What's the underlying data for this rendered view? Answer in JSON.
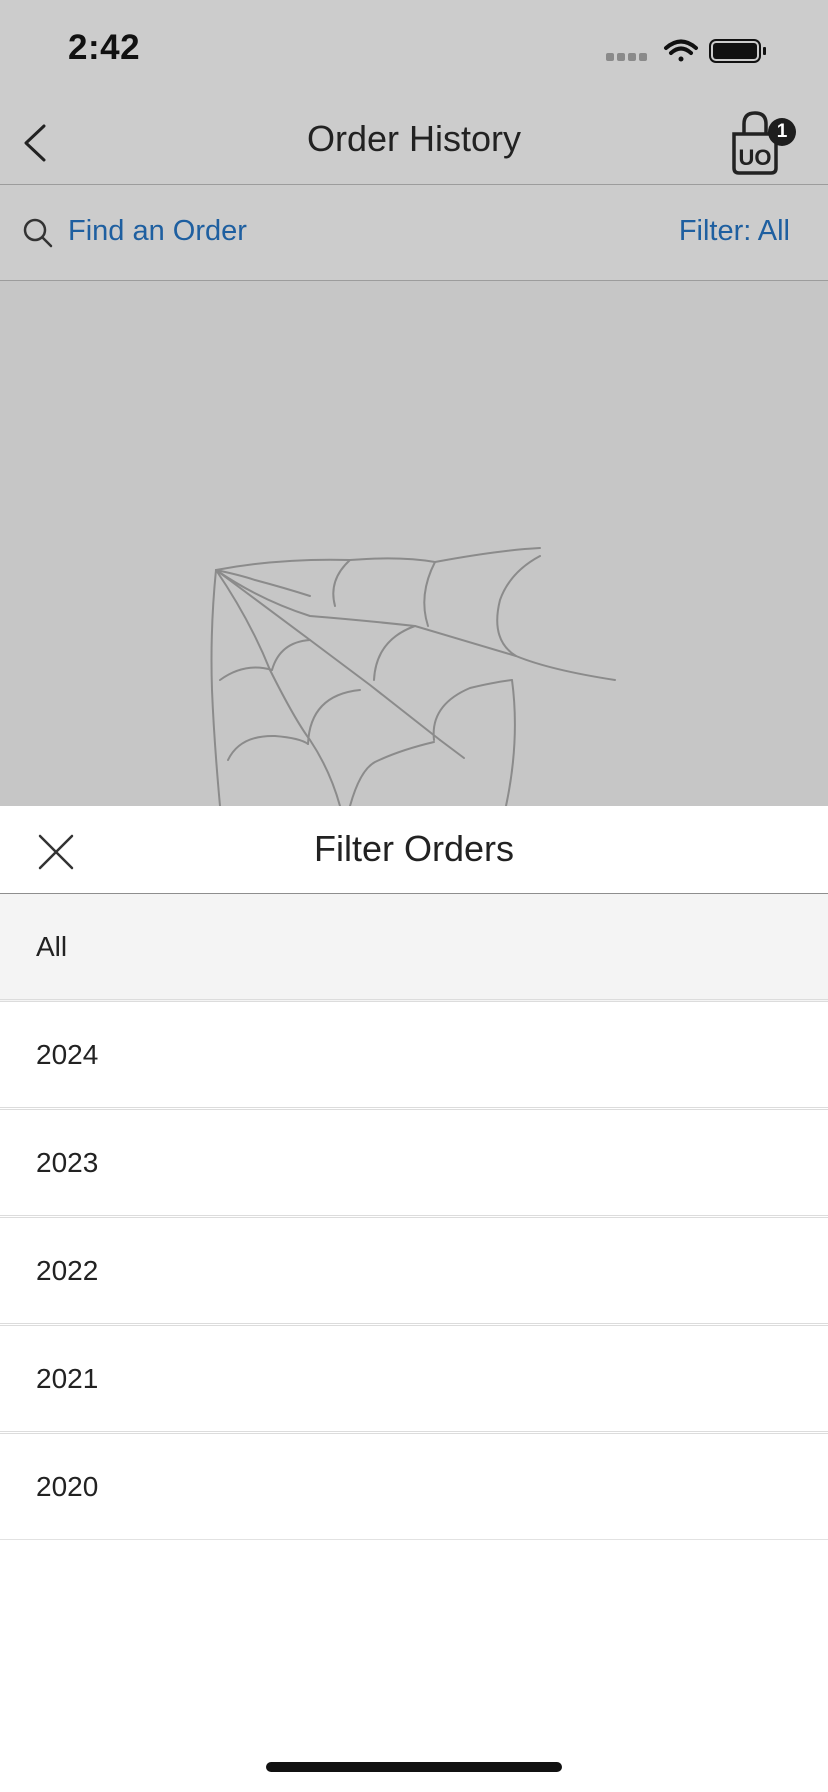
{
  "status_bar": {
    "time": "2:42",
    "icons": [
      "signal-dots-icon",
      "wifi-icon",
      "battery-icon"
    ]
  },
  "nav": {
    "title": "Order History",
    "back_icon": "chevron-left-icon",
    "cart_icon": "shopping-bag-icon",
    "cart_logo": "UO",
    "cart_count": "1"
  },
  "search": {
    "icon": "search-icon",
    "label": "Find an Order",
    "filter_label": "Filter: All"
  },
  "background_art": {
    "icon": "spider-web-illustration"
  },
  "filter_sheet": {
    "title": "Filter Orders",
    "close_icon": "close-icon",
    "selected_option": "All",
    "options": [
      {
        "label": "All"
      },
      {
        "label": "2024"
      },
      {
        "label": "2023"
      },
      {
        "label": "2022"
      },
      {
        "label": "2021"
      },
      {
        "label": "2020"
      }
    ]
  },
  "colors": {
    "link": "#1e5fa0",
    "dim_overlay": "#c6c6c6",
    "selected_row": "#f4f4f4",
    "badge": "#1e1e1e"
  }
}
